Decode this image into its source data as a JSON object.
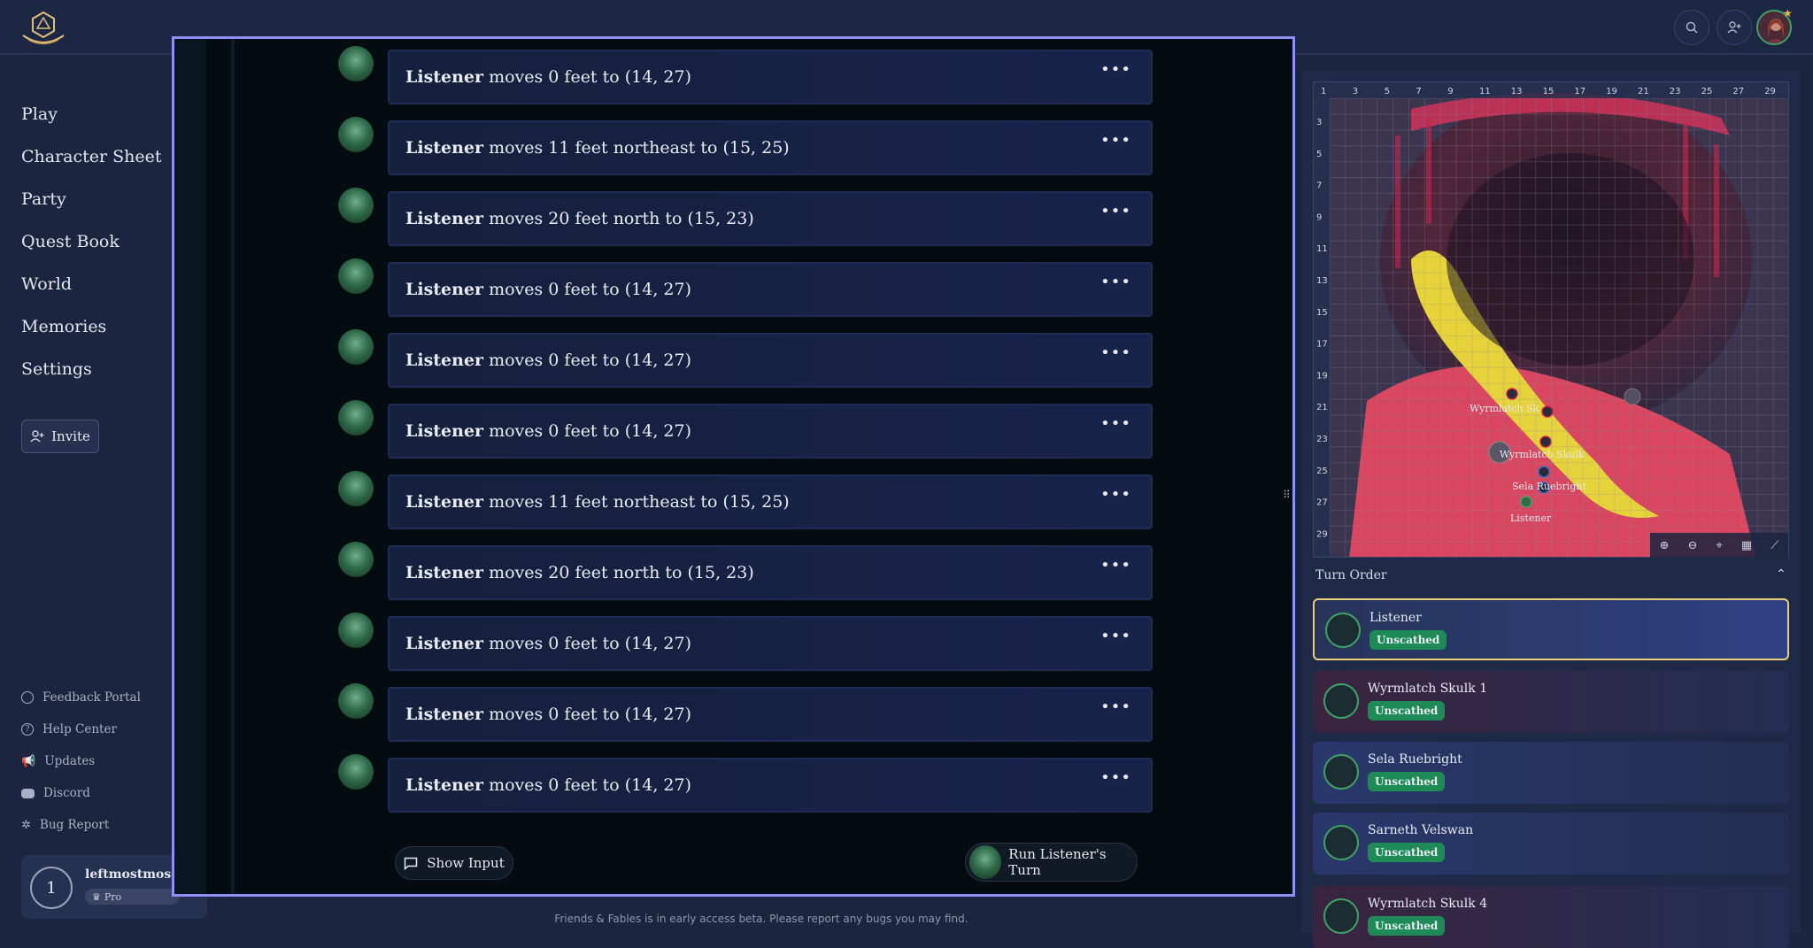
{
  "sidebar": {
    "nav": [
      "Play",
      "Character Sheet",
      "Party",
      "Quest Book",
      "World",
      "Memories",
      "Settings"
    ],
    "invite_label": "Invite",
    "footer_links": [
      "Feedback Portal",
      "Help Center",
      "Updates",
      "Discord",
      "Bug Report"
    ],
    "user": {
      "initial": "1",
      "name": "leftmostmoss",
      "plan": "Pro"
    }
  },
  "chat": {
    "messages": [
      {
        "actor": "Listener",
        "text": "moves 0 feet to (14, 27)"
      },
      {
        "actor": "Listener",
        "text": "moves 11 feet northeast to (15, 25)"
      },
      {
        "actor": "Listener",
        "text": "moves 20 feet north to (15, 23)"
      },
      {
        "actor": "Listener",
        "text": "moves 0 feet to (14, 27)"
      },
      {
        "actor": "Listener",
        "text": "moves 0 feet to (14, 27)"
      },
      {
        "actor": "Listener",
        "text": "moves 0 feet to (14, 27)"
      },
      {
        "actor": "Listener",
        "text": "moves 11 feet northeast to (15, 25)"
      },
      {
        "actor": "Listener",
        "text": "moves 20 feet north to (15, 23)"
      },
      {
        "actor": "Listener",
        "text": "moves 0 feet to (14, 27)"
      },
      {
        "actor": "Listener",
        "text": "moves 0 feet to (14, 27)"
      },
      {
        "actor": "Listener",
        "text": "moves 0 feet to (14, 27)"
      }
    ],
    "more_glyph": "•••",
    "show_input_label": "Show Input",
    "run_turn_label": "Run Listener's Turn"
  },
  "beta_note": "Friends & Fables is in early access beta. Please report any bugs you may find.",
  "map": {
    "col_labels": [
      "1",
      "3",
      "5",
      "7",
      "9",
      "11",
      "13",
      "15",
      "17",
      "19",
      "21",
      "23",
      "25",
      "27",
      "29"
    ],
    "row_labels": [
      "3",
      "5",
      "7",
      "9",
      "11",
      "13",
      "15",
      "17",
      "19",
      "21",
      "23",
      "25",
      "27",
      "29"
    ],
    "token_labels": [
      "Wyrmlatch Sk",
      "Wyrmlatch Skulk",
      "Sela Ruebright",
      "Listener"
    ]
  },
  "turn_order": {
    "title": "Turn Order",
    "entries": [
      {
        "name": "Listener",
        "status": "Unscathed"
      },
      {
        "name": "Wyrmlatch Skulk 1",
        "status": "Unscathed"
      },
      {
        "name": "Sela Ruebright",
        "status": "Unscathed"
      },
      {
        "name": "Sarneth Velswan",
        "status": "Unscathed"
      },
      {
        "name": "Wyrmlatch Skulk 4",
        "status": "Unscathed"
      }
    ]
  },
  "colors": {
    "active_turn_bg": "#2f4183",
    "active_turn_border": "#e9cf7a",
    "enemy_turn_bg": "#3a2440",
    "ally_turn_bg": "#28386b",
    "status_badge": "#1e8a56",
    "selection_frame": "#8f8ff5"
  },
  "icons": {
    "logo": "d20-crest-icon",
    "search": "search-icon",
    "add_user": "add-user-icon",
    "more": "more-horizontal-icon"
  }
}
